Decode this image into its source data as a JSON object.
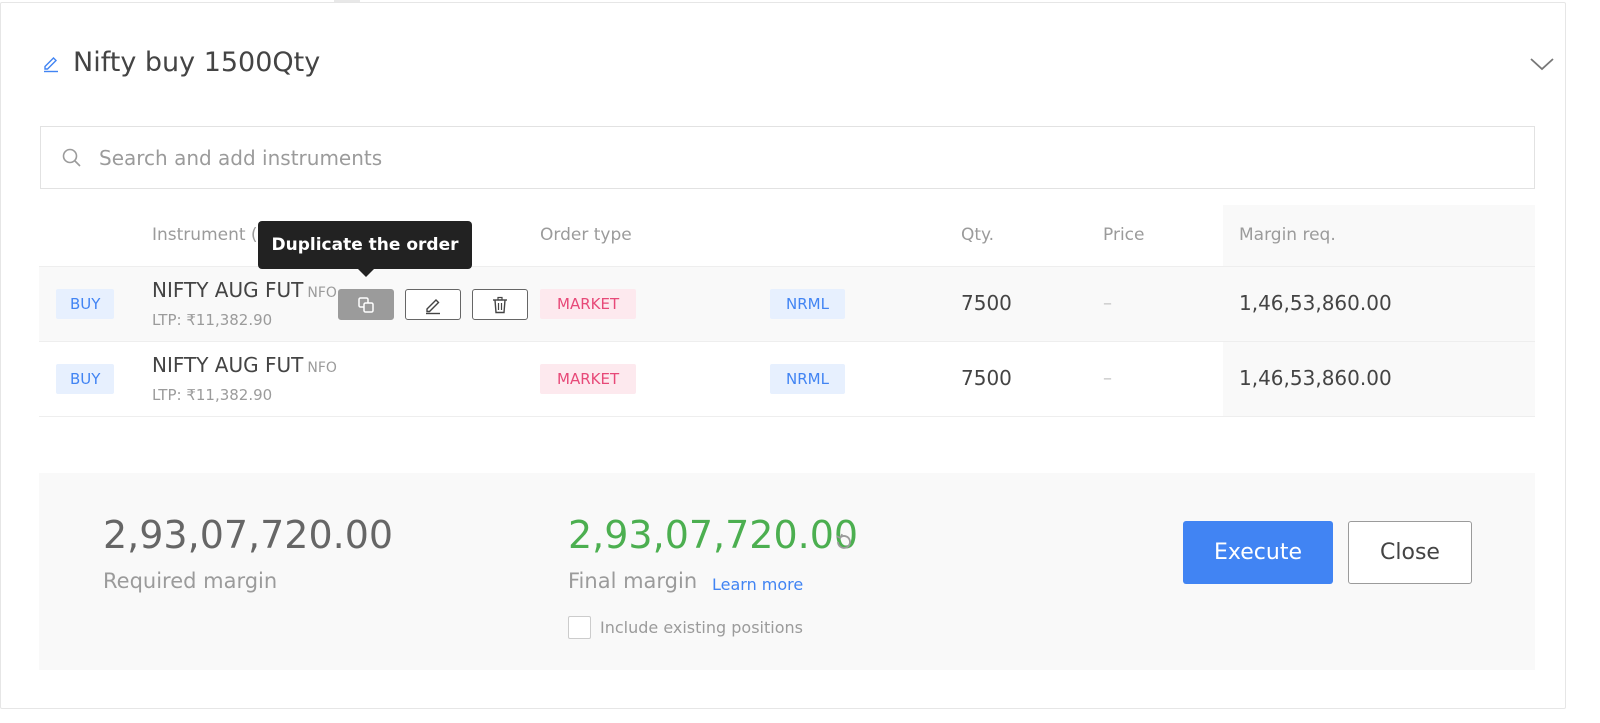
{
  "basket": {
    "title": "Nifty buy 1500Qty"
  },
  "search": {
    "placeholder": "Search and add instruments"
  },
  "table": {
    "headers": {
      "instrument": "Instrument (2 / 20)",
      "order_type": "Order type",
      "qty": "Qty.",
      "price": "Price",
      "margin": "Margin req."
    },
    "rows": [
      {
        "side": "BUY",
        "instrument": "NIFTY AUG FUT",
        "exchange": "NFO",
        "ltp": "LTP: ₹11,382.90",
        "order_type": "MARKET",
        "product": "NRML",
        "qty": "7500",
        "price": "–",
        "margin": "1,46,53,860.00"
      },
      {
        "side": "BUY",
        "instrument": "NIFTY AUG FUT",
        "exchange": "NFO",
        "ltp": "LTP: ₹11,382.90",
        "order_type": "MARKET",
        "product": "NRML",
        "qty": "7500",
        "price": "–",
        "margin": "1,46,53,860.00"
      }
    ]
  },
  "tooltip": {
    "text": "Duplicate the order"
  },
  "summary": {
    "required_margin": "2,93,07,720.00",
    "required_margin_label": "Required margin",
    "final_margin": "2,93,07,720.00",
    "final_margin_label": "Final margin",
    "learn_more": "Learn more",
    "include_positions_label": "Include existing positions",
    "include_positions_checked": false
  },
  "buttons": {
    "execute": "Execute",
    "close": "Close"
  },
  "colors": {
    "accent_blue": "#4184f3",
    "market_pink": "#e74978",
    "final_green": "#4caf50"
  },
  "icons": [
    "edit-icon",
    "chevron-down-icon",
    "search-icon",
    "duplicate-icon",
    "pencil-icon",
    "trash-icon",
    "refresh-icon"
  ]
}
